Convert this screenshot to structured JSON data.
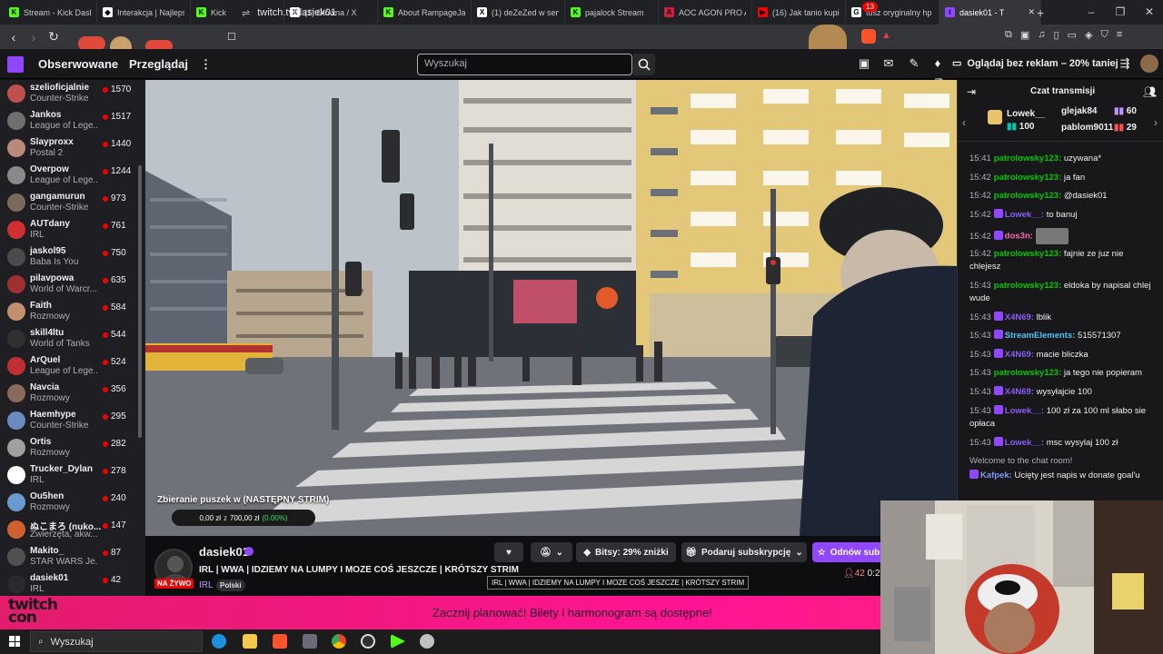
{
  "browser": {
    "tabs": [
      {
        "label": "Stream - Kick Dashb",
        "color": "#53fc18",
        "glyph": "K"
      },
      {
        "label": "Interakcja | Najlepsz",
        "color": "#ffffff",
        "glyph": "◆"
      },
      {
        "label": "Kick",
        "color": "#53fc18",
        "glyph": "K"
      },
      {
        "label": "(1) Główna / X",
        "color": "#ffffff",
        "glyph": "X"
      },
      {
        "label": "About RampageJack",
        "color": "#53fc18",
        "glyph": "K"
      },
      {
        "label": "(1) deZeZed w serw",
        "color": "#ffffff",
        "glyph": "X"
      },
      {
        "label": "pajalock Stream",
        "color": "#53fc18",
        "glyph": "K"
      },
      {
        "label": "AOC AGON PRO AG",
        "color": "#d01f3c",
        "glyph": "A"
      },
      {
        "label": "(16) Jak tanio kupić",
        "color": "#ff0000",
        "glyph": "▶"
      },
      {
        "label": "tusz oryginalny hp",
        "color": "#ffffff",
        "glyph": "G"
      },
      {
        "label": "dasiek01 - T",
        "color": "#9146ff",
        "glyph": "t"
      }
    ],
    "new_tab": "+",
    "url": "twitch.tv/dasiek01"
  },
  "header": {
    "nav": [
      "Obserwowane",
      "Przeglądaj"
    ],
    "search_placeholder": "Wyszukaj",
    "notifications": "13",
    "promo": "Oglądaj bez reklam – 20% taniej"
  },
  "sidebar": {
    "channels": [
      {
        "name": "szelioficjalnie",
        "category": "Counter-Strike",
        "viewers": "1570",
        "color": "#c0504d"
      },
      {
        "name": "Jankos",
        "category": "League of Lege...",
        "viewers": "1517",
        "color": "#6f6f6f"
      },
      {
        "name": "Slayproxx",
        "category": "Postal 2",
        "viewers": "1440",
        "color": "#b98a7a"
      },
      {
        "name": "Overpow",
        "category": "League of Lege...",
        "viewers": "1244",
        "color": "#8a8a8a"
      },
      {
        "name": "gangamurun",
        "category": "Counter-Strike",
        "viewers": "973",
        "color": "#7a6a5a"
      },
      {
        "name": "AUTdany",
        "category": "IRL",
        "viewers": "761",
        "color": "#d03030"
      },
      {
        "name": "jaskol95",
        "category": "Baba Is You",
        "viewers": "750",
        "color": "#4a4a4a"
      },
      {
        "name": "pilavpowa",
        "category": "World of Warcr...",
        "viewers": "635",
        "color": "#a03030"
      },
      {
        "name": "Faith",
        "category": "Rozmowy",
        "viewers": "584",
        "color": "#c09070"
      },
      {
        "name": "skill4ltu",
        "category": "World of Tanks",
        "viewers": "544",
        "color": "#303030"
      },
      {
        "name": "ArQuel",
        "category": "League of Lege...",
        "viewers": "524",
        "color": "#c03030"
      },
      {
        "name": "Navcia",
        "category": "Rozmowy",
        "viewers": "356",
        "color": "#8a6a5a"
      },
      {
        "name": "Haemhype",
        "category": "Counter-Strike",
        "viewers": "295",
        "color": "#6a8ac0"
      },
      {
        "name": "Ortis",
        "category": "Rozmowy",
        "viewers": "282",
        "color": "#a0a0a0"
      },
      {
        "name": "Trucker_Dylan",
        "category": "IRL",
        "viewers": "278",
        "color": "#ffffff"
      },
      {
        "name": "Ou5hen",
        "category": "Rozmowy",
        "viewers": "240",
        "color": "#6a9ad0"
      },
      {
        "name": "ぬこまろ (nuko...",
        "category": "Zwierzęta, akw...",
        "viewers": "147",
        "color": "#d06030"
      },
      {
        "name": "Makito_",
        "category": "STAR WARS Je...",
        "viewers": "87",
        "color": "#505050"
      },
      {
        "name": "dasiek01",
        "category": "IRL",
        "viewers": "42",
        "color": "#2a2a2a"
      }
    ]
  },
  "video": {
    "goal_title": "Zbieranie puszek w (NASTĘPNY STRIM)",
    "goal_current": "0,00 zł",
    "goal_sep": "z",
    "goal_target": "700,00 zł",
    "goal_percent": "(0.00%)",
    "goal_fraction": 0.0
  },
  "stream": {
    "streamer": "dasiek01",
    "live_label": "NA ŻYWO",
    "title": "IRL | WWA | IDZIEMY NA LUMPY I MOZE COŚ JESZCZE | KRÓTSZY STRIM",
    "category": "IRL",
    "tag": "Polski",
    "bits": "Bitsy: 29% zniżki",
    "gift": "Podaruj subskrypcję",
    "follow": "Odnów sub",
    "viewers": "42",
    "uptime": "0:2",
    "tooltip": "IRL | WWA | IDZIEMY NA LUMPY I MOZE COŚ JESZCZE | KRÓTSZY STRIM"
  },
  "chat": {
    "title": "Czat transmisji",
    "leaderboard": {
      "first_name": "Lowek__",
      "first_amount": "100",
      "second_name": "glejak84",
      "second_amount": "60",
      "third_name": "pablom9011",
      "third_amount": "29"
    },
    "messages": [
      {
        "time": "15:41",
        "user": "patrolowsky123:",
        "text": "uzywana*",
        "color": "#00c800"
      },
      {
        "time": "15:42",
        "user": "patrolowsky123:",
        "text": "ja fan",
        "color": "#00c800"
      },
      {
        "time": "15:42",
        "user": "patrolowsky123:",
        "text": "@dasiek01",
        "color": "#00c800"
      },
      {
        "time": "15:42",
        "user": "Lowek__:",
        "text": "to banuj",
        "color": "#8a5cf6"
      },
      {
        "time": "15:42",
        "user": "dos3n:",
        "text": "",
        "color": "#ff69b4"
      },
      {
        "time": "15:42",
        "user": "patrolowsky123:",
        "text": "fajnie ze juz nie chlejesz",
        "color": "#00c800"
      },
      {
        "time": "15:43",
        "user": "patrolowsky123:",
        "text": "eldoka by napisal chlej wude",
        "color": "#00c800"
      },
      {
        "time": "15:43",
        "user": "X4N69:",
        "text": "lblik",
        "color": "#8a5cf6"
      },
      {
        "time": "15:43",
        "user": "StreamElements:",
        "text": "515571307",
        "color": "#4fc3f7"
      },
      {
        "time": "15:43",
        "user": "X4N69:",
        "text": "macie bliczka",
        "color": "#8a5cf6"
      },
      {
        "time": "15:43",
        "user": "patrolowsky123:",
        "text": "ja tego nie popieram",
        "color": "#00c800"
      },
      {
        "time": "15:43",
        "user": "X4N69:",
        "text": "wysyłajcie 100",
        "color": "#8a5cf6"
      },
      {
        "time": "15:43",
        "user": "Lowek__:",
        "text": "100 zł za 100 ml słabo sie opłaca",
        "color": "#8a5cf6"
      },
      {
        "time": "15:43",
        "user": "Lowek__:",
        "text": "msc wysylaj 100 zł",
        "color": "#8a5cf6"
      },
      {
        "time": "",
        "user": "",
        "text": "Welcome to the chat room!",
        "color": "#adadb8"
      },
      {
        "time": "",
        "user": "Kafpek:",
        "text": "Ucięty jest napis w donate goal'u",
        "color": "#7c9cf6"
      }
    ]
  },
  "banner": {
    "text": "Zacznij planować! Bilety i harmonogram są dostępne!",
    "logo_line1": "twitch",
    "logo_line2": "con"
  },
  "taskbar": {
    "search": "Wyszukaj"
  }
}
